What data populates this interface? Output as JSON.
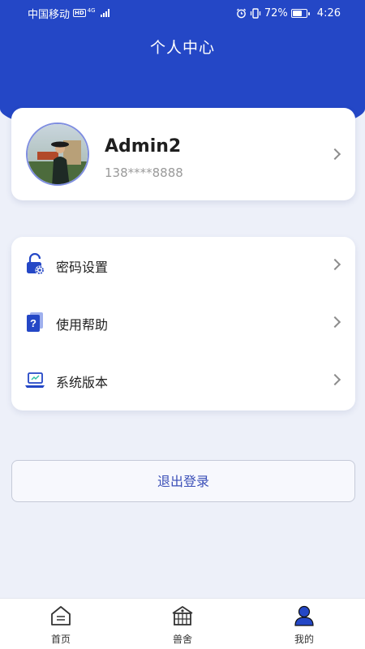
{
  "status_bar": {
    "carrier": "中国移动",
    "network_badge": "HD",
    "network_type": "4G",
    "battery": "72%",
    "time": "4:26"
  },
  "header": {
    "title": "个人中心"
  },
  "profile": {
    "username": "Admin2",
    "phone": "138****8888",
    "avatar_icon": "user-photo"
  },
  "menu": {
    "items": [
      {
        "label": "密码设置",
        "icon": "lock-gear-icon"
      },
      {
        "label": "使用帮助",
        "icon": "help-book-icon"
      },
      {
        "label": "系统版本",
        "icon": "laptop-icon"
      }
    ]
  },
  "logout": {
    "label": "退出登录"
  },
  "tabbar": {
    "items": [
      {
        "label": "首页",
        "icon": "home-icon",
        "active": false
      },
      {
        "label": "兽舍",
        "icon": "barn-icon",
        "active": false
      },
      {
        "label": "我的",
        "icon": "user-icon",
        "active": true
      }
    ]
  },
  "colors": {
    "primary": "#2447c6",
    "background": "#edf0f9",
    "logout_text": "#3b4fb8"
  }
}
